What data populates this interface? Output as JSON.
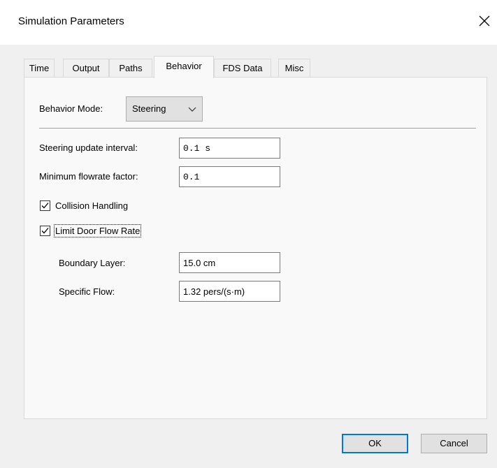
{
  "window": {
    "title": "Simulation Parameters"
  },
  "tabs": [
    {
      "label": "Time"
    },
    {
      "label": "Output"
    },
    {
      "label": "Paths"
    },
    {
      "label": "Behavior"
    },
    {
      "label": "FDS Data"
    },
    {
      "label": "Misc"
    }
  ],
  "behavior": {
    "mode_label": "Behavior Mode:",
    "mode_value": "Steering",
    "steering_interval_label": "Steering update interval:",
    "steering_interval_value": "0.1 s",
    "min_flowrate_label": "Minimum flowrate factor:",
    "min_flowrate_value": "0.1",
    "collision_label": "Collision Handling",
    "collision_checked": true,
    "limit_door_label": "Limit Door Flow Rate",
    "limit_door_checked": true,
    "boundary_label": "Boundary Layer:",
    "boundary_value": "15.0 cm",
    "specific_flow_label": "Specific Flow:",
    "specific_flow_value": "1.32 pers/(s·m)"
  },
  "buttons": {
    "ok": "OK",
    "cancel": "Cancel"
  }
}
